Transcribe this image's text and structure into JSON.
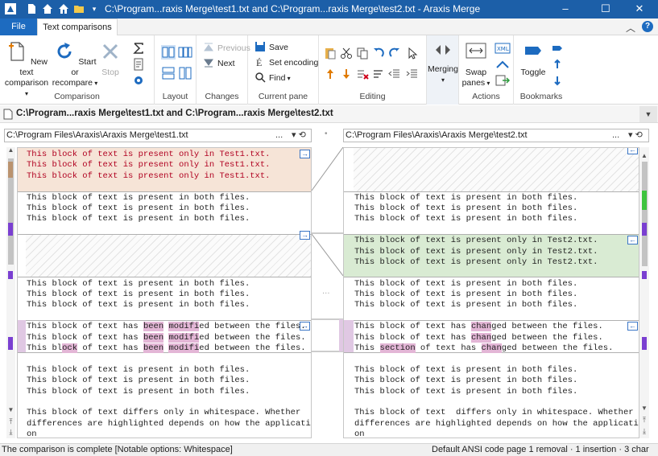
{
  "window": {
    "title": "C:\\Program...raxis Merge\\test1.txt and C:\\Program...raxis Merge\\test2.txt - Araxis Merge",
    "minimize": "–",
    "maximize": "☐",
    "close": "✕"
  },
  "ribbon_tabs": {
    "file": "File",
    "text_comparisons": "Text comparisons",
    "collapse": "︿",
    "help": "?"
  },
  "ribbon": {
    "comparison": {
      "new_text_comparison": "New text\ncomparison",
      "start_or_recompare": "Start or\nrecompare",
      "stop": "Stop",
      "group_label": "Comparison"
    },
    "layout": {
      "group_label": "Layout"
    },
    "changes": {
      "previous": "Previous",
      "next": "Next",
      "group_label": "Changes"
    },
    "current_pane": {
      "save": "Save",
      "set_encoding": "Set encoding",
      "find": "Find",
      "group_label": "Current pane"
    },
    "editing": {
      "group_label": "Editing"
    },
    "merging": {
      "label": "Merging"
    },
    "actions": {
      "swap_panes": "Swap\npanes",
      "group_label": "Actions"
    },
    "bookmarks": {
      "toggle": "Toggle",
      "group_label": "Bookmarks"
    }
  },
  "path_bar": {
    "text": "C:\\Program...raxis Merge\\test1.txt and C:\\Program...raxis Merge\\test2.txt"
  },
  "left_file": {
    "path": "C:\\Program Files\\Araxis\\Araxis Merge\\test1.txt",
    "more": "...",
    "history": "▾ ⟲"
  },
  "right_file": {
    "path": "C:\\Program Files\\Araxis\\Araxis Merge\\test2.txt",
    "more": "...",
    "history": "▾ ⟲"
  },
  "left_lines": [
    "This block of text is present only in Test1.txt.",
    "This block of text is present only in Test1.txt.",
    "This block of text is present only in Test1.txt.",
    "",
    "This block of text is present in both files.",
    "This block of text is present in both files.",
    "This block of text is present in both files.",
    "",
    "",
    "",
    "",
    "",
    "This block of text is present in both files.",
    "This block of text is present in both files.",
    "This block of text is present in both files.",
    "",
    "This block of text has been modified between the files.",
    "This block of text has been modified between the files.",
    "This block of text has been modified between the files.",
    "",
    "This block of text is present in both files.",
    "This block of text is present in both files.",
    "This block of text is present in both files.",
    "",
    "This block of text differs only in whitespace. Whether",
    "differences are highlighted depends on how the applicati",
    "on"
  ],
  "right_lines": [
    "",
    "",
    "",
    "",
    "This block of text is present in both files.",
    "This block of text is present in both files.",
    "This block of text is present in both files.",
    "",
    "This block of text is present only in Test2.txt.",
    "This block of text is present only in Test2.txt.",
    "This block of text is present only in Test2.txt.",
    "",
    "This block of text is present in both files.",
    "This block of text is present in both files.",
    "This block of text is present in both files.",
    "",
    "This block of text has changed between the files.",
    "This block of text has changed between the files.",
    "This section of text has changed between the files.",
    "",
    "This block of text is present in both files.",
    "This block of text is present in both files.",
    "This block of text is present in both files.",
    "",
    "This block of text  differs only in whitespace. Whether",
    "differences are highlighted depends on how the applicati",
    "on"
  ],
  "status": {
    "left": "The comparison is complete [Notable options: Whitespace]",
    "right": "Default ANSI code page  1 removal · 1 insertion · 3 char"
  },
  "colors": {
    "titlebar": "#1c5fa8",
    "removed_block": "#f6e4d7",
    "inserted_block": "#d9ebd3",
    "changed_highlight": "#e3b6d6",
    "accent": "#1d6bc0"
  }
}
